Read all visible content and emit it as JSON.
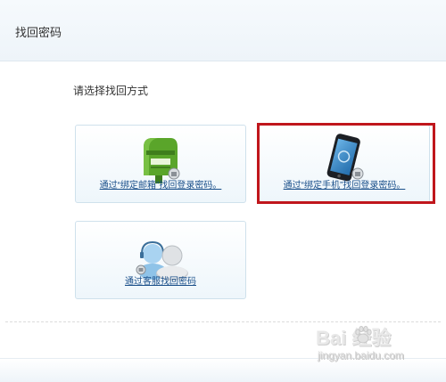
{
  "header": {
    "title": "找回密码"
  },
  "main": {
    "prompt": "请选择找回方式",
    "options": [
      {
        "label": "通过“绑定邮箱”找回登录密码。",
        "icon": "mailbox-icon",
        "highlighted": false
      },
      {
        "label": "通过“绑定手机”找回登录密码。",
        "icon": "smartphone-icon",
        "highlighted": true
      },
      {
        "label": "通过客服找回密码",
        "icon": "customer-service-icon",
        "highlighted": false
      }
    ]
  },
  "watermark": {
    "logo": "Bai 经验",
    "url": "jingyan.baidu.com"
  },
  "colors": {
    "link": "#1a4f8a",
    "highlight_border": "#c0161c",
    "mailbox_green": "#5aa52a"
  }
}
